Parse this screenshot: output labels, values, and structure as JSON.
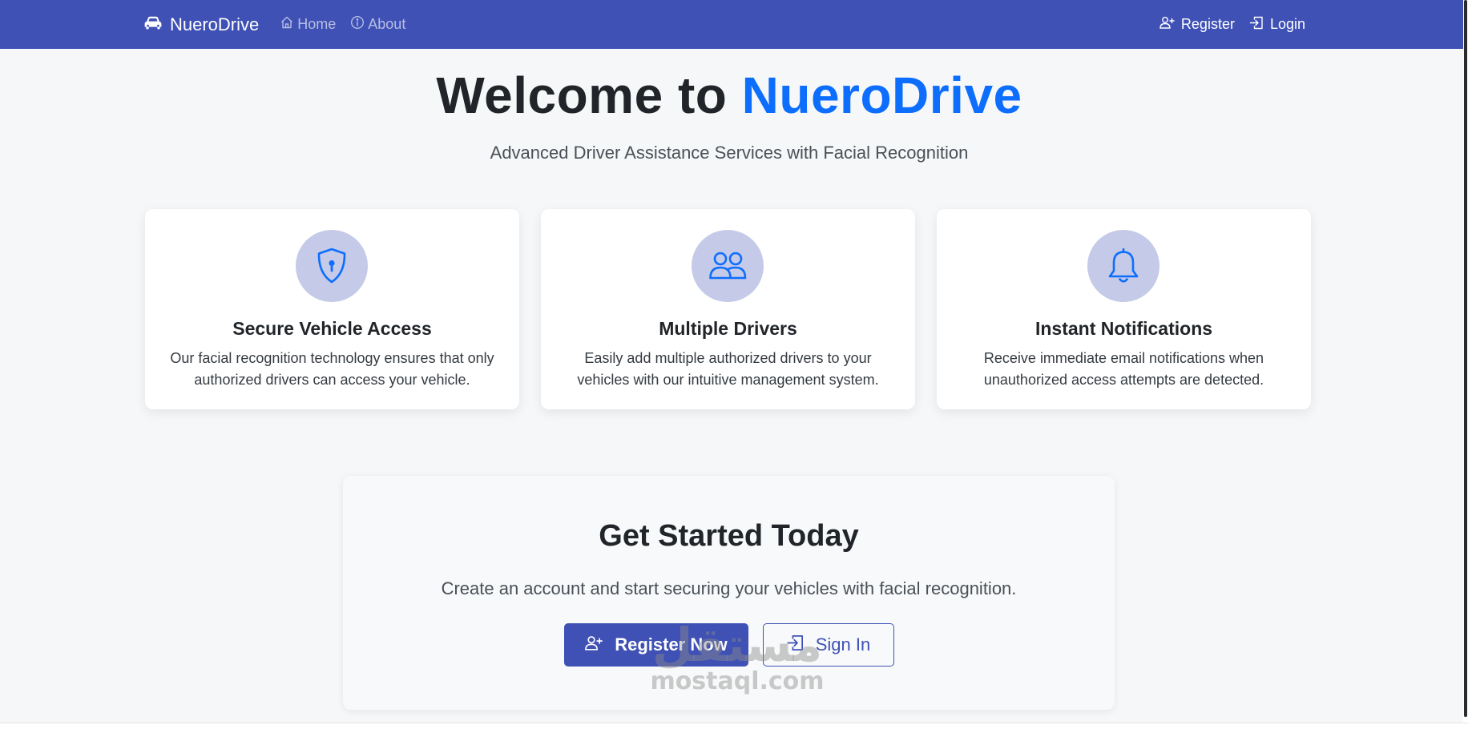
{
  "navbar": {
    "brand": "NueroDrive",
    "links": {
      "home": "Home",
      "about": "About"
    },
    "right": {
      "register": "Register",
      "login": "Login"
    }
  },
  "hero": {
    "title_prefix": "Welcome to ",
    "title_accent": "NueroDrive",
    "subtitle": "Advanced Driver Assistance Services with Facial Recognition"
  },
  "features": [
    {
      "title": "Secure Vehicle Access",
      "description": "Our facial recognition technology ensures that only authorized drivers can access your vehicle.",
      "icon": "shield-lock-icon"
    },
    {
      "title": "Multiple Drivers",
      "description": "Easily add multiple authorized drivers to your vehicles with our intuitive management system.",
      "icon": "people-icon"
    },
    {
      "title": "Instant Notifications",
      "description": "Receive immediate email notifications when unauthorized access attempts are detected.",
      "icon": "bell-icon"
    }
  ],
  "cta": {
    "title": "Get Started Today",
    "subtitle": "Create an account and start securing your vehicles with facial recognition.",
    "register_button": "Register Now",
    "signin_button": "Sign In"
  },
  "watermark": {
    "arabic": "مستقل",
    "latin": "mostaql.com"
  },
  "colors": {
    "navbar": "#3f51b5",
    "accent": "#0d6efd",
    "icon_circle": "#c5cae9",
    "icon_stroke": "#0d6efd",
    "background": "#f6f7f8"
  }
}
